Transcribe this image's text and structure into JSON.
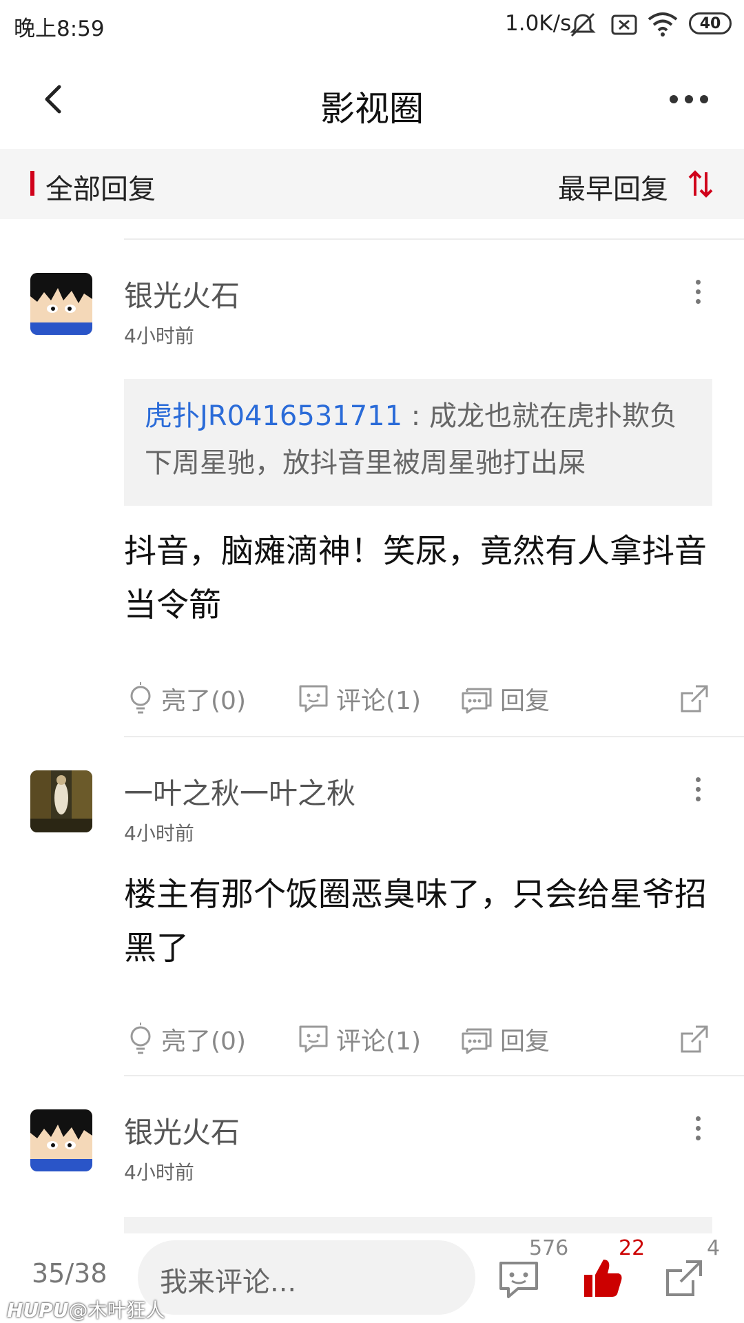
{
  "status_bar": {
    "time": "晚上8:59",
    "speed": "1.0K/s",
    "battery": "40"
  },
  "nav": {
    "title": "影视圈",
    "back_icon": "chevron-left-icon",
    "more_icon": "more-horizontal-icon"
  },
  "filter_bar": {
    "label": "全部回复",
    "sort_label": "最早回复",
    "sort_icon": "sort-arrows-icon",
    "accent_color": "#d0021b"
  },
  "comments": [
    {
      "username": "银光火石",
      "time": "4小时前",
      "quote": {
        "user": "虎扑JR0416531711",
        "separator": " : ",
        "text": "成龙也就在虎扑欺负下周星驰，放抖音里被周星驰打出屎"
      },
      "text": "抖音，脑瘫滴神！笑尿，竟然有人拿抖音当令箭",
      "actions": {
        "light": "亮了(0)",
        "comment": "评论(1)",
        "reply": "回复"
      }
    },
    {
      "username": "一叶之秋一叶之秋",
      "time": "4小时前",
      "text": "楼主有那个饭圈恶臭味了，只会给星爷招黑了",
      "actions": {
        "light": "亮了(0)",
        "comment": "评论(1)",
        "reply": "回复"
      }
    },
    {
      "username": "银光火石",
      "time": "4小时前"
    }
  ],
  "bottom_bar": {
    "page_indicator": "35/38",
    "comment_placeholder": "我来评论...",
    "comment_count": "576",
    "like_count": "22",
    "share_count": "4",
    "like_color": "#cc0000"
  },
  "watermark": {
    "brand": "HUPU",
    "author": "@木叶狂人"
  }
}
